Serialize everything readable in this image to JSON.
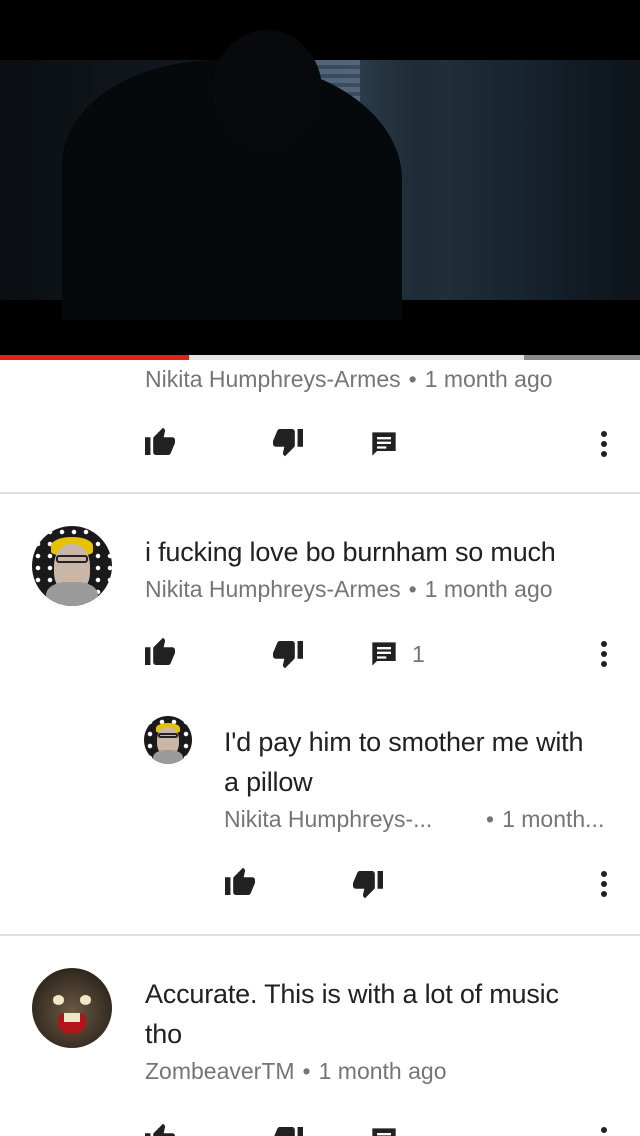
{
  "player": {
    "progress_played": 0.295,
    "progress_buffered": 0.82
  },
  "comments": [
    {
      "author": "Nikita Humphreys-Armes",
      "time": "1 month ago",
      "actions": {
        "like_icon": "thumb-up-icon",
        "dislike_icon": "thumb-down-icon",
        "reply_icon": "reply-icon",
        "more_icon": "more-vert-icon"
      }
    },
    {
      "text": "i fucking love bo burnham so much",
      "author": "Nikita Humphreys-Armes",
      "time": "1 month ago",
      "reply_count": "1"
    },
    {
      "text_line1": "I'd pay him to smother me with",
      "text_line2": "a pillow",
      "author": "Nikita Humphreys-...",
      "time": "1 month..."
    },
    {
      "text_line1": "Accurate. This is with a lot of music",
      "text_line2": "tho",
      "author": "ZombeaverTM",
      "time": "1 month ago"
    }
  ],
  "separator": "•",
  "colors": {
    "progress": "#e62117",
    "icon": "#212121",
    "meta": "#757575"
  }
}
